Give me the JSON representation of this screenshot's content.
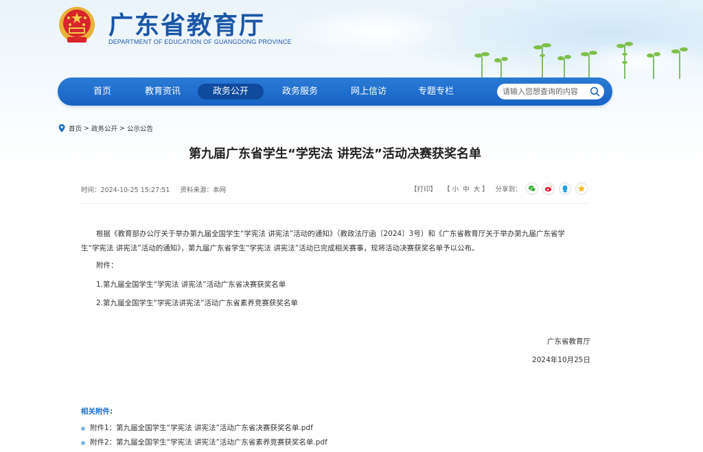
{
  "header": {
    "site_title": "广东省教育厅",
    "site_subtitle": "DEPARTMENT OF EDUCATION OF GUANGDONG PROVINCE"
  },
  "nav": {
    "items": [
      {
        "label": "首页"
      },
      {
        "label": "教育资讯"
      },
      {
        "label": "政务公开",
        "active": true
      },
      {
        "label": "政务服务"
      },
      {
        "label": "网上信访"
      },
      {
        "label": "专题专栏"
      }
    ],
    "search_placeholder": "请输入您想查询的内容"
  },
  "breadcrumb": {
    "items": [
      "首页",
      "政务公开",
      "公示公告"
    ],
    "separator": ">"
  },
  "article": {
    "title": "第九届广东省学生“学宪法 讲宪法”活动决赛获奖名单",
    "meta_time": "时间：2024-10-25 15:27:51",
    "meta_source": "资料来源：本网",
    "print_label": "【打印】",
    "font_size_label": "【 小  中  大 】",
    "share_label": "分享到：",
    "share_icons": [
      "wechat-icon",
      "weibo-icon",
      "qq-icon",
      "favorite-icon"
    ],
    "paragraph_line1": "根据《教育部办公厅关于举办第九届全国学生“学宪法 讲宪法”活动的通知》（教政法厅函〔2024〕3号）和《广东省教育厅关于举办第九届广东省学",
    "paragraph_line2": "生“学宪法 讲宪法”活动的通知》，第九届广东省学生“学宪法 讲宪法”活动已完成相关赛事，现将活动决赛获奖名单予以公布。",
    "attachments_label": "附件：",
    "attachment_item1": "1.第九届全国学生“学宪法 讲宪法”活动广东省决赛获奖名单",
    "attachment_item2": "2.第九届全国学生“学宪法讲宪法”活动广东省素养竞赛获奖名单",
    "signature_org": "广东省教育厅",
    "signature_date": "2024年10月25日"
  },
  "related": {
    "heading": "相关附件:",
    "files": [
      "附件1：第九届全国学生“学宪法 讲宪法”活动广东省决赛获奖名单.pdf",
      "附件2：第九届全国学生“学宪法 讲宪法”活动广东省素养竞赛获奖名单.pdf"
    ]
  },
  "colors": {
    "brand_blue": "#1a56a8",
    "nav_blue": "#1662c4",
    "nav_active": "#0f4a9c",
    "attach_heading": "#1a6fc9"
  }
}
